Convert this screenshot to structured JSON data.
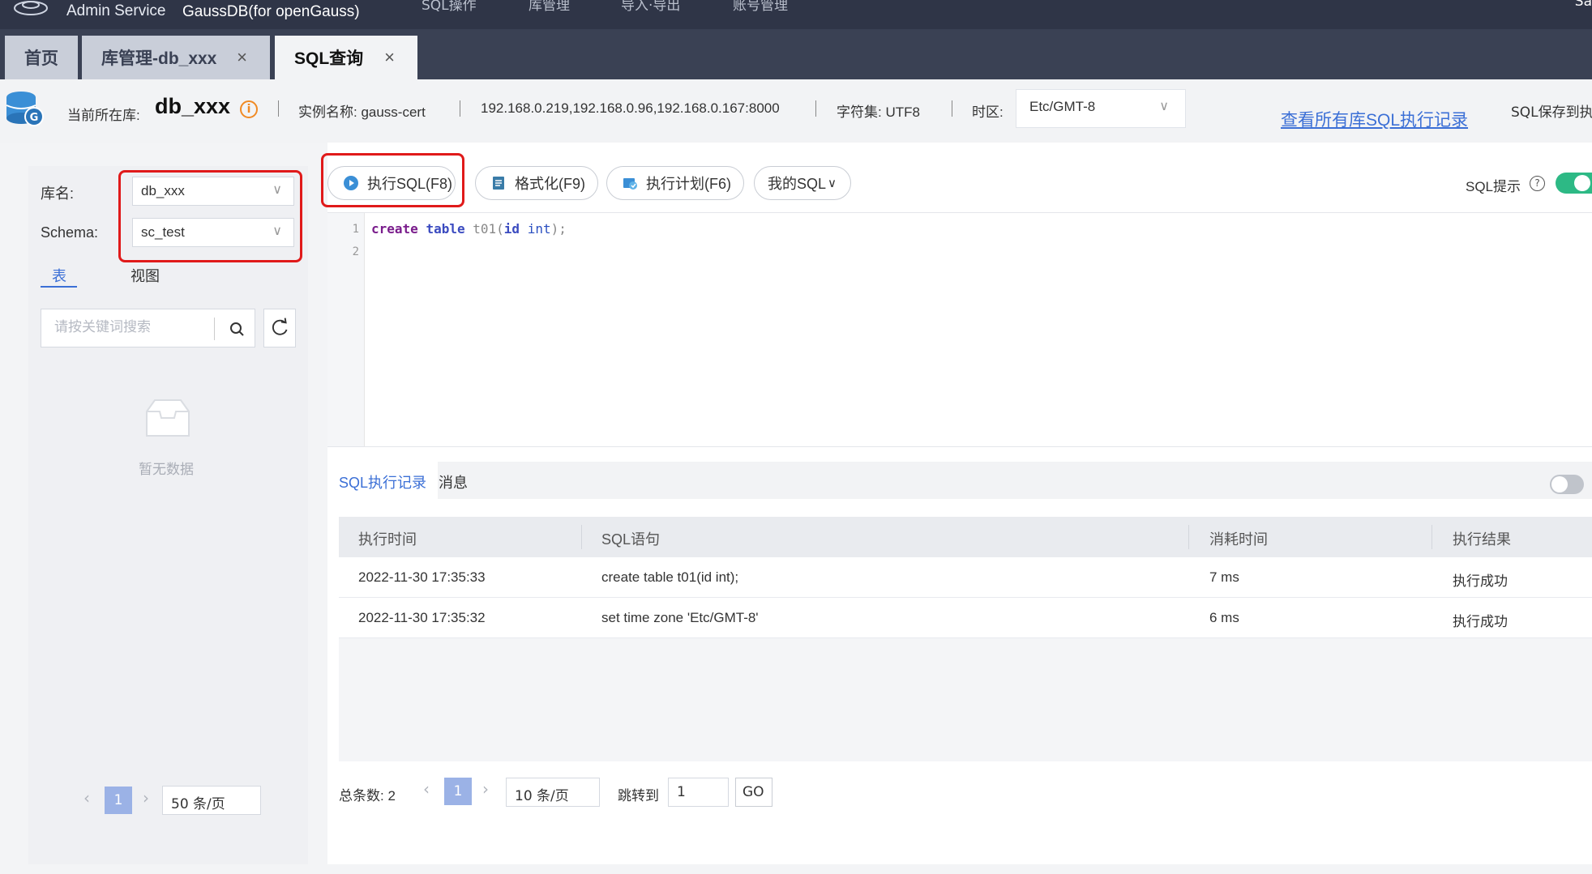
{
  "header": {
    "brand": "Admin Service",
    "product": "GaussDB(for openGauss)",
    "nav": [
      "SQL操作",
      "库管理",
      "导入·导出",
      "账号管理"
    ],
    "user_cut": "Sa"
  },
  "tabs": [
    {
      "label": "首页",
      "closable": false,
      "active": false
    },
    {
      "label": "库管理-db_xxx",
      "closable": true,
      "active": false
    },
    {
      "label": "SQL查询",
      "closable": true,
      "active": true
    }
  ],
  "info": {
    "current_db_label": "当前所在库:",
    "current_db": "db_xxx",
    "instance_label": "实例名称: gauss-cert",
    "address": "192.168.0.219,192.168.0.96,192.168.0.167:8000",
    "charset": "字符集: UTF8",
    "timezone_label": "时区:",
    "timezone": "Etc/GMT-8",
    "history_link": "查看所有库SQL执行记录",
    "save_cut": "SQL保存到执"
  },
  "left": {
    "db_label": "库名:",
    "db_value": "db_xxx",
    "schema_label": "Schema:",
    "schema_value": "sc_test",
    "tab_table": "表",
    "tab_view": "视图",
    "search_placeholder": "请按关键词搜索",
    "empty_text": "暂无数据",
    "page": "1",
    "page_size": "50 条/页"
  },
  "toolbar": {
    "execute": "执行SQL(F8)",
    "format": "格式化(F9)",
    "plan": "执行计划(F6)",
    "my_sql": "我的SQL",
    "sql_tip": "SQL提示"
  },
  "editor": {
    "lines": [
      "1",
      "2"
    ],
    "code": {
      "kw1": "create",
      "kw2": "table",
      "ident": "t01",
      "p1": "(",
      "col": "id",
      "type": "int",
      "p2": ");"
    }
  },
  "results": {
    "tab_history": "SQL执行记录",
    "tab_messages": "消息",
    "columns": [
      "执行时间",
      "SQL语句",
      "消耗时间",
      "执行结果"
    ],
    "rows": [
      [
        "2022-11-30 17:35:33",
        "create table t01(id int);",
        "7 ms",
        "执行成功"
      ],
      [
        "2022-11-30 17:35:32",
        "set time zone 'Etc/GMT-8'",
        "6 ms",
        "执行成功"
      ]
    ],
    "total": "总条数: 2",
    "page": "1",
    "page_size": "10 条/页",
    "jump_label": "跳转到",
    "jump_value": "1",
    "go": "GO"
  },
  "colors": {
    "accent": "#3b6fd6",
    "highlight": "#e01a1a",
    "toggle_on": "#2db985",
    "topbar": "#2f3547"
  }
}
